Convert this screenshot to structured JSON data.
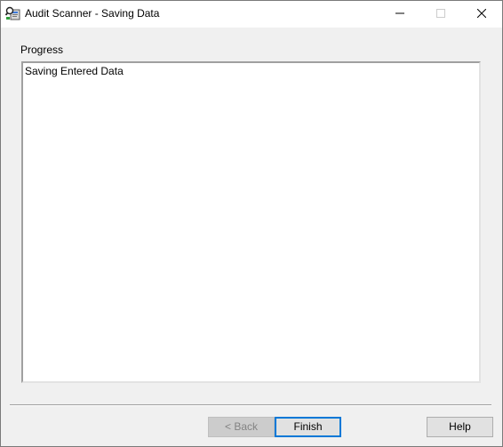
{
  "window": {
    "title": "Audit Scanner - Saving Data",
    "app_icon": "audit-scanner-app-icon",
    "controls": {
      "minimize_icon": "minimize-icon",
      "maximize_icon": "maximize-icon",
      "close_icon": "close-icon"
    }
  },
  "main": {
    "progress_label": "Progress",
    "log_lines": [
      "Saving Entered Data"
    ]
  },
  "footer": {
    "back_label": "< Back",
    "back_enabled": false,
    "finish_label": "Finish",
    "help_label": "Help"
  },
  "colors": {
    "focus_border": "#0078d7",
    "window_bg": "#f0f0f0",
    "titlebar_bg": "#ffffff"
  }
}
